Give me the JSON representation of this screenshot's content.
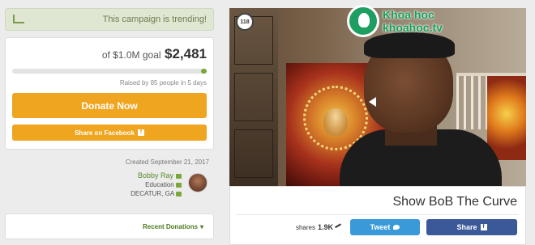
{
  "trending": {
    "text": "This campaign is trending!",
    "icon": "trending-chart-icon"
  },
  "donation": {
    "amount": "$2,481",
    "goal": "of $1.0M goal",
    "progress_fraction": 0.03,
    "raised_text": "Raised by 85 people in 5 days",
    "donate_label": "Donate Now",
    "facebook_share_label": "Share on Facebook",
    "facebook_icon_glyph": "f"
  },
  "created": "Created September 21, 2017",
  "organizer": {
    "name": "Bobby Ray",
    "category": "Education",
    "location": "DECATUR, GA"
  },
  "recent_donations_label": "Recent Donations",
  "video": {
    "badge_count": "118",
    "logo_text_line1": "Khoa hoc",
    "logo_text_line2": "khoahoc.tv"
  },
  "campaign": {
    "title": "Show BoB The Curve",
    "share_label": "Share",
    "tweet_label": "Tweet",
    "shares_count": "1.9K",
    "shares_label": "shares"
  },
  "colors": {
    "accent_orange": "#f0a520",
    "progress_green": "#7aa83b",
    "facebook_blue": "#3b5998",
    "twitter_blue": "#3a9ad9",
    "trending_bg": "#dfe6d2"
  }
}
